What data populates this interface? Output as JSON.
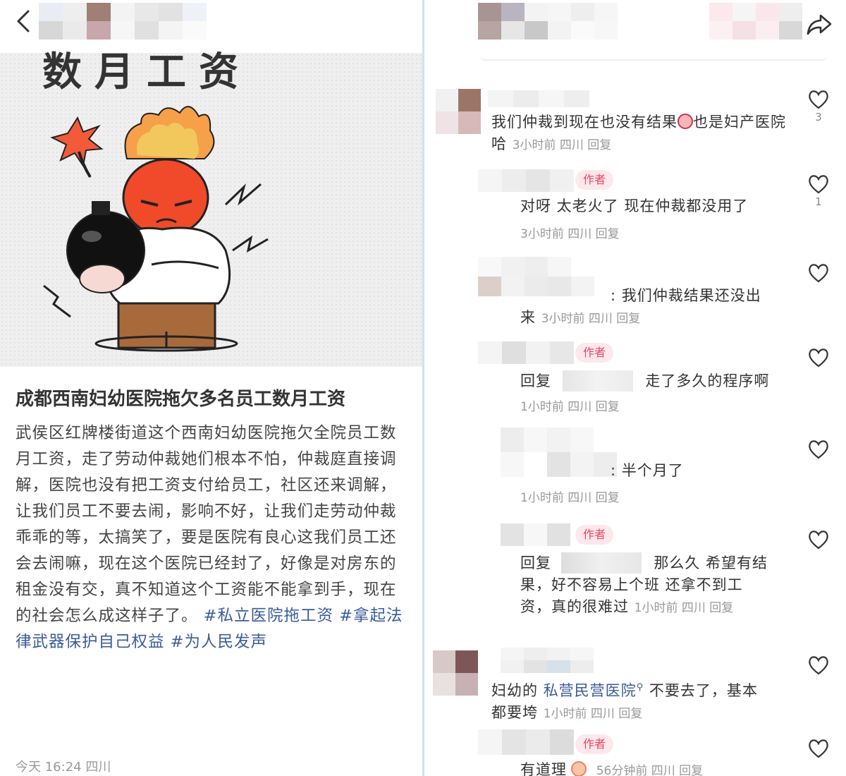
{
  "post": {
    "hero_text": "数月工资",
    "title": "成都西南妇幼医院拖欠多名员工数月工资",
    "body_text": "武侯区红牌楼街道这个西南妇幼医院拖欠全院员工数月工资，走了劳动仲裁她们根本不怕，仲裁庭直接调解，医院也没有把工资支付给员工，社区还来调解，让我们员工不要去闹，影响不好，让我们走劳动仲裁乖乖的等，太搞笑了，要是医院有良心这我们员工还会去闹嘛，现在这个医院已经封了，好像是对房东的租金没有交，真不知道这个工资能不能拿到手，现在的社会怎么成这样子了。",
    "tags": [
      "#私立医院拖工资",
      "#拿起法律武器保护自己权益",
      "#为人民发声"
    ],
    "footer": "今天 16:24 四川"
  },
  "comments": {
    "c1": {
      "text": "我们仲裁到现在也没有结果",
      "text2": "也是妇产医院哈",
      "meta": "3小时前 四川 回复",
      "likes": "3"
    },
    "c2": {
      "badge": "作者",
      "text": "对呀 太老火了 现在仲裁都没用了",
      "meta": "3小时前 四川 回复",
      "likes": "1"
    },
    "c3": {
      "text_prefix": ": 我们仲裁结果还没出",
      "text2": "来",
      "meta": "3小时前 四川 回复"
    },
    "c4": {
      "badge": "作者",
      "reply": "回复",
      "text": "走了多久的程序啊",
      "meta": "1小时前 四川 回复"
    },
    "c5": {
      "text": ": 半个月了",
      "meta": "1小时前 四川 回复"
    },
    "c6": {
      "badge": "作者",
      "reply": "回复",
      "text": "那么久 希望有结",
      "text2": "果，好不容易上个班 还拿不到工",
      "text3": "资，真的很难过",
      "meta": "1小时前 四川 回复"
    },
    "c7": {
      "text_a": "妇幼的",
      "link": "私营民营医院",
      "text_b": "不要去了，基本",
      "text2": "都要垮",
      "meta": "1小时前 四川 回复"
    },
    "c8": {
      "badge": "作者",
      "text": "有道理",
      "meta": "56分钟前 四川 回复"
    }
  },
  "icons": {
    "back": "chevron-left-icon",
    "share": "share-icon",
    "like": "heart-outline-icon"
  },
  "colors": {
    "tag": "#3b5b9a",
    "author_badge_bg": "#fde8ec",
    "author_badge_text": "#e94567",
    "meta": "#999999"
  }
}
